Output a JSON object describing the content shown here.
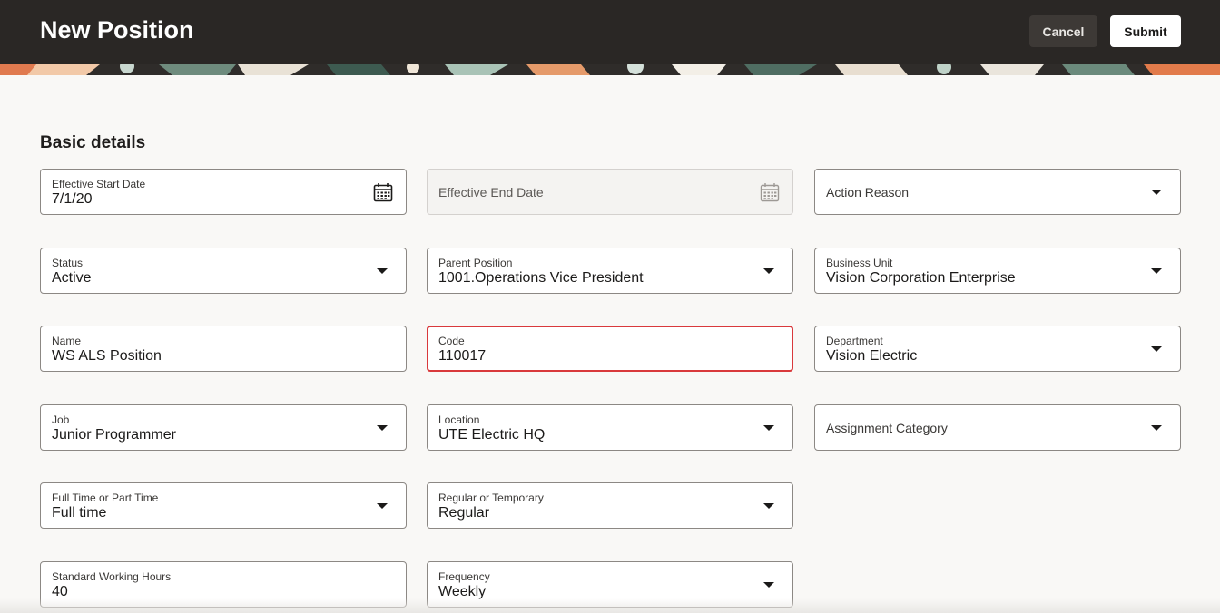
{
  "header": {
    "title": "New Position",
    "cancel_label": "Cancel",
    "submit_label": "Submit"
  },
  "section": {
    "title": "Basic details"
  },
  "fields": {
    "effective_start_date": {
      "label": "Effective Start Date",
      "value": "7/1/20"
    },
    "effective_end_date": {
      "placeholder": "Effective End Date"
    },
    "action_reason": {
      "placeholder": "Action Reason"
    },
    "status": {
      "label": "Status",
      "value": "Active"
    },
    "parent_position": {
      "label": "Parent Position",
      "value": "1001.Operations Vice President"
    },
    "business_unit": {
      "label": "Business Unit",
      "value": "Vision Corporation Enterprise"
    },
    "name": {
      "label": "Name",
      "value": "WS ALS Position"
    },
    "code": {
      "label": "Code",
      "value": "110017"
    },
    "department": {
      "label": "Department",
      "value": "Vision Electric"
    },
    "job": {
      "label": "Job",
      "value": "Junior Programmer"
    },
    "location": {
      "label": "Location",
      "value": "UTE Electric HQ"
    },
    "assignment_category": {
      "placeholder": "Assignment Category"
    },
    "full_part_time": {
      "label": "Full Time or Part Time",
      "value": "Full time"
    },
    "regular_temporary": {
      "label": "Regular or Temporary",
      "value": "Regular"
    },
    "standard_working_hours": {
      "label": "Standard Working Hours",
      "value": "40"
    },
    "frequency": {
      "label": "Frequency",
      "value": "Weekly"
    }
  },
  "icons": {
    "calendar": "calendar-icon",
    "dropdown": "chevron-down-icon"
  },
  "colors": {
    "header_bg": "#2a2725",
    "highlight_border": "#d9393c",
    "page_bg": "#f9f8f6"
  }
}
